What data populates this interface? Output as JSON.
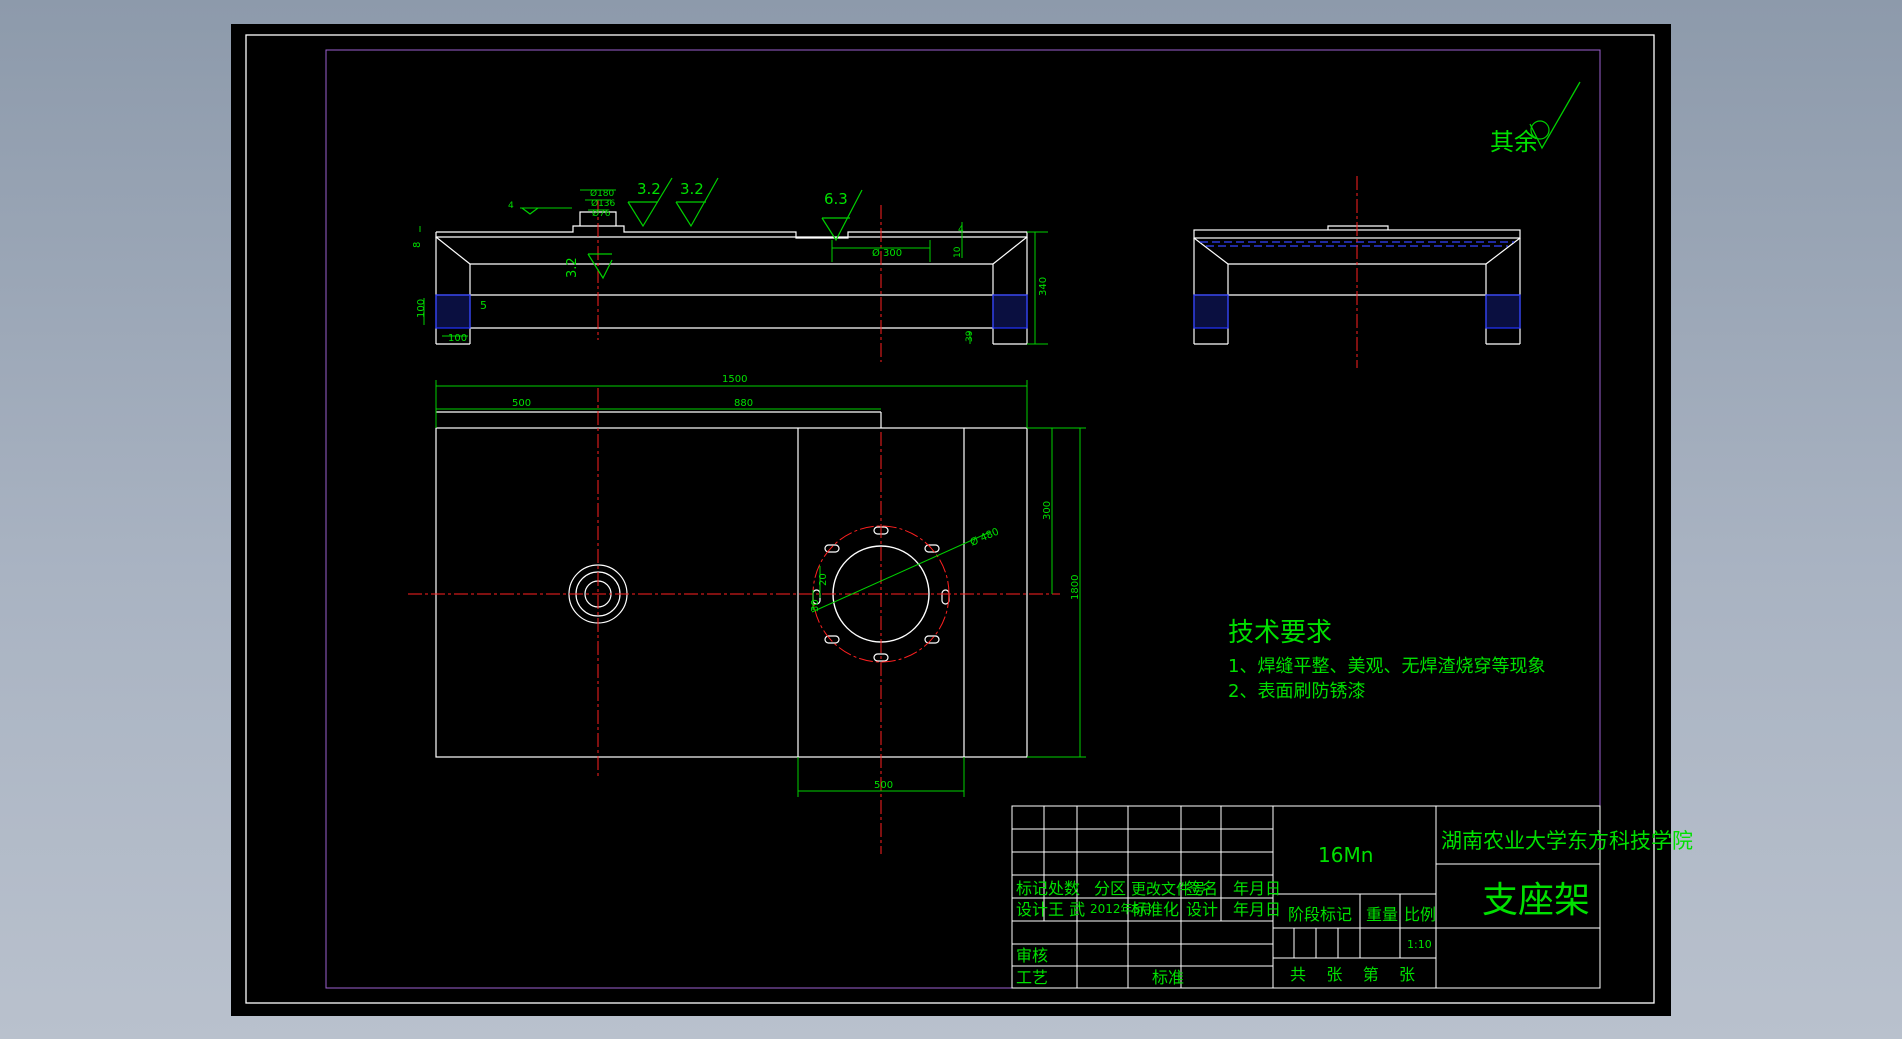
{
  "surface_roughness": {
    "general_label": "其余",
    "front_values": [
      "3.2",
      "3.2",
      "6.3",
      "3.2"
    ]
  },
  "dimensions": {
    "front": {
      "d_top": "Ø180",
      "d_mid": "Ø136",
      "d_low": "Ø76",
      "bore": "Ø 300",
      "height": "340",
      "leg_h": "100",
      "leg_w": "100",
      "gap": "5",
      "top_t": "8",
      "right_t": "10",
      "small_l": "4",
      "small_r": "4",
      "foot": "39"
    },
    "plan": {
      "overall_len": "1500",
      "left_off": "500",
      "right_off": "880",
      "pcd": "Ø 480",
      "slot_w": "20",
      "slot_l": "30",
      "half_w": "300",
      "total_w": "1800",
      "pad_w": "500"
    }
  },
  "notes": {
    "title": "技术要求",
    "lines": [
      "1、焊缝平整、美观、无焊渣烧穿等现象",
      "2、表面刷防锈漆"
    ]
  },
  "title_block": {
    "material": "16Mn",
    "school": "湖南农业大学东方科技学院",
    "part_name": "支座架",
    "row_a": [
      "标记",
      "处数",
      "分区",
      "更改文件号",
      "签名",
      "年月日"
    ],
    "row_b": [
      "设计",
      "王 武",
      "2012年5月",
      "标准化",
      "设计",
      "年月日"
    ],
    "review": "审核",
    "process": "工艺",
    "approve": "标准",
    "stage_mark": "阶段标记",
    "weight": "重量",
    "scale_label": "比例",
    "scale": "1:10",
    "sheets": "共    张    第    张"
  }
}
